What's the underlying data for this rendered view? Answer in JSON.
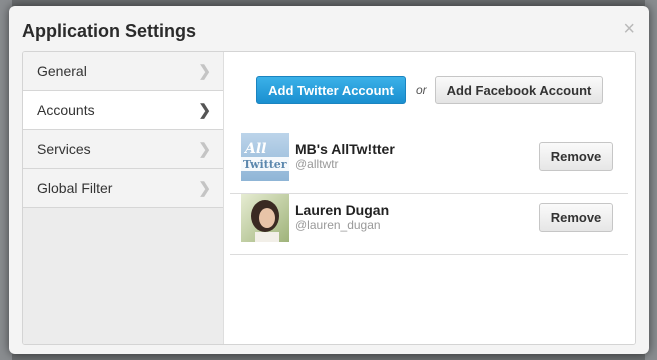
{
  "dialog": {
    "title": "Application Settings",
    "close_glyph": "×"
  },
  "sidebar": {
    "items": [
      {
        "label": "General",
        "active": false
      },
      {
        "label": "Accounts",
        "active": true
      },
      {
        "label": "Services",
        "active": false
      },
      {
        "label": "Global Filter",
        "active": false
      }
    ]
  },
  "actions": {
    "add_twitter": "Add Twitter Account",
    "or": "or",
    "add_facebook": "Add Facebook Account"
  },
  "accounts": [
    {
      "name": "MB's AllTw!tter",
      "handle": "@alltwtr",
      "avatar_text": "All Twitter",
      "remove_label": "Remove"
    },
    {
      "name": "Lauren Dugan",
      "handle": "@lauren_dugan",
      "remove_label": "Remove"
    }
  ],
  "colors": {
    "primary": "#1a8fd0",
    "overlay": "#6b6e70"
  }
}
